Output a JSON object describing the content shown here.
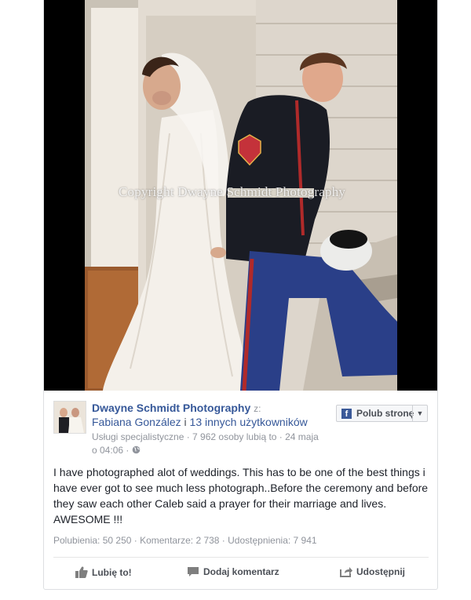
{
  "photo": {
    "watermark": "Copyright Dwayne Schmidt Photography"
  },
  "post": {
    "page_name": "Dwayne Schmidt Photography",
    "from_label": "z:",
    "shared_by_first": "Fabiana González",
    "shared_by_sep": " i ",
    "shared_by_rest": "13 innych użytkowników",
    "meta_line1": "Usługi specjalistyczne · 7 962 osoby lubią to · 24 maja",
    "meta_line2": "o 04:06 ·",
    "like_page_label": "Polub stronę",
    "text": "I have photographed alot of weddings. This has to be one of the best things i have ever got to see much less photograph..Before the ceremony and before they saw each other Caleb said a prayer for their marriage and lives. AWESOME !!!",
    "stats": "Polubienia: 50 250 · Komentarze: 2 738 · Udostępnienia: 7 941",
    "actions": {
      "like": "Lubię to!",
      "comment": "Dodaj komentarz",
      "share": "Udostępnij"
    }
  },
  "colors": {
    "link": "#365899",
    "muted": "#90949c",
    "fb_blue": "#3b5998"
  },
  "icons": [
    "globe-icon",
    "facebook-f-icon",
    "chevron-down-icon",
    "thumbs-up-icon",
    "comment-icon",
    "share-icon"
  ]
}
